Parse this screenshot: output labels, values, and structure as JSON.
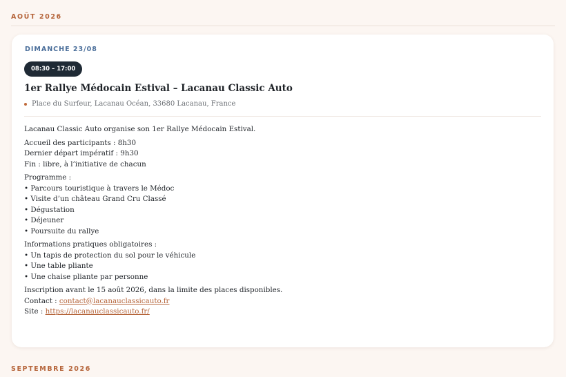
{
  "sections": {
    "current_month": "AOÛT 2026",
    "next_month": "SEPTEMBRE 2026"
  },
  "event": {
    "date": "DIMANCHE 23/08",
    "time": "08:30 – 17:00",
    "title": "1er Rallye Médocain Estival – Lacanau Classic Auto",
    "location": "Place du Surfeur, Lacanau Océan, 33680 Lacanau, France",
    "intro": "Lacanau Classic Auto organise son 1er Rallye Médocain Estival.",
    "schedule": [
      "Accueil des participants : 8h30",
      "Dernier départ impératif : 9h30",
      "Fin : libre, à l’initiative de chacun"
    ],
    "programme_label": "Programme :",
    "programme": [
      "• Parcours touristique à travers le Médoc",
      "• Visite d’un château Grand Cru Classé",
      "• Dégustation",
      "• Déjeuner",
      "• Poursuite du rallye"
    ],
    "info_label": "Informations pratiques obligatoires :",
    "info": [
      "• Un tapis de protection du sol pour le véhicule",
      "• Une table pliante",
      "• Une chaise pliante par personne"
    ],
    "registration": "Inscription avant le 15 août 2026, dans la limite des places disponibles.",
    "contact_label": "Contact : ",
    "contact_email": "contact@lacanauclassicauto.fr",
    "site_label": "Site : ",
    "site_url": "https://lacanauclassicauto.fr/"
  },
  "colors": {
    "accent": "#b5643a",
    "date_blue": "#4a6e9a",
    "pill_dark": "#1f2a35",
    "page_bg": "#fcf6f2"
  }
}
